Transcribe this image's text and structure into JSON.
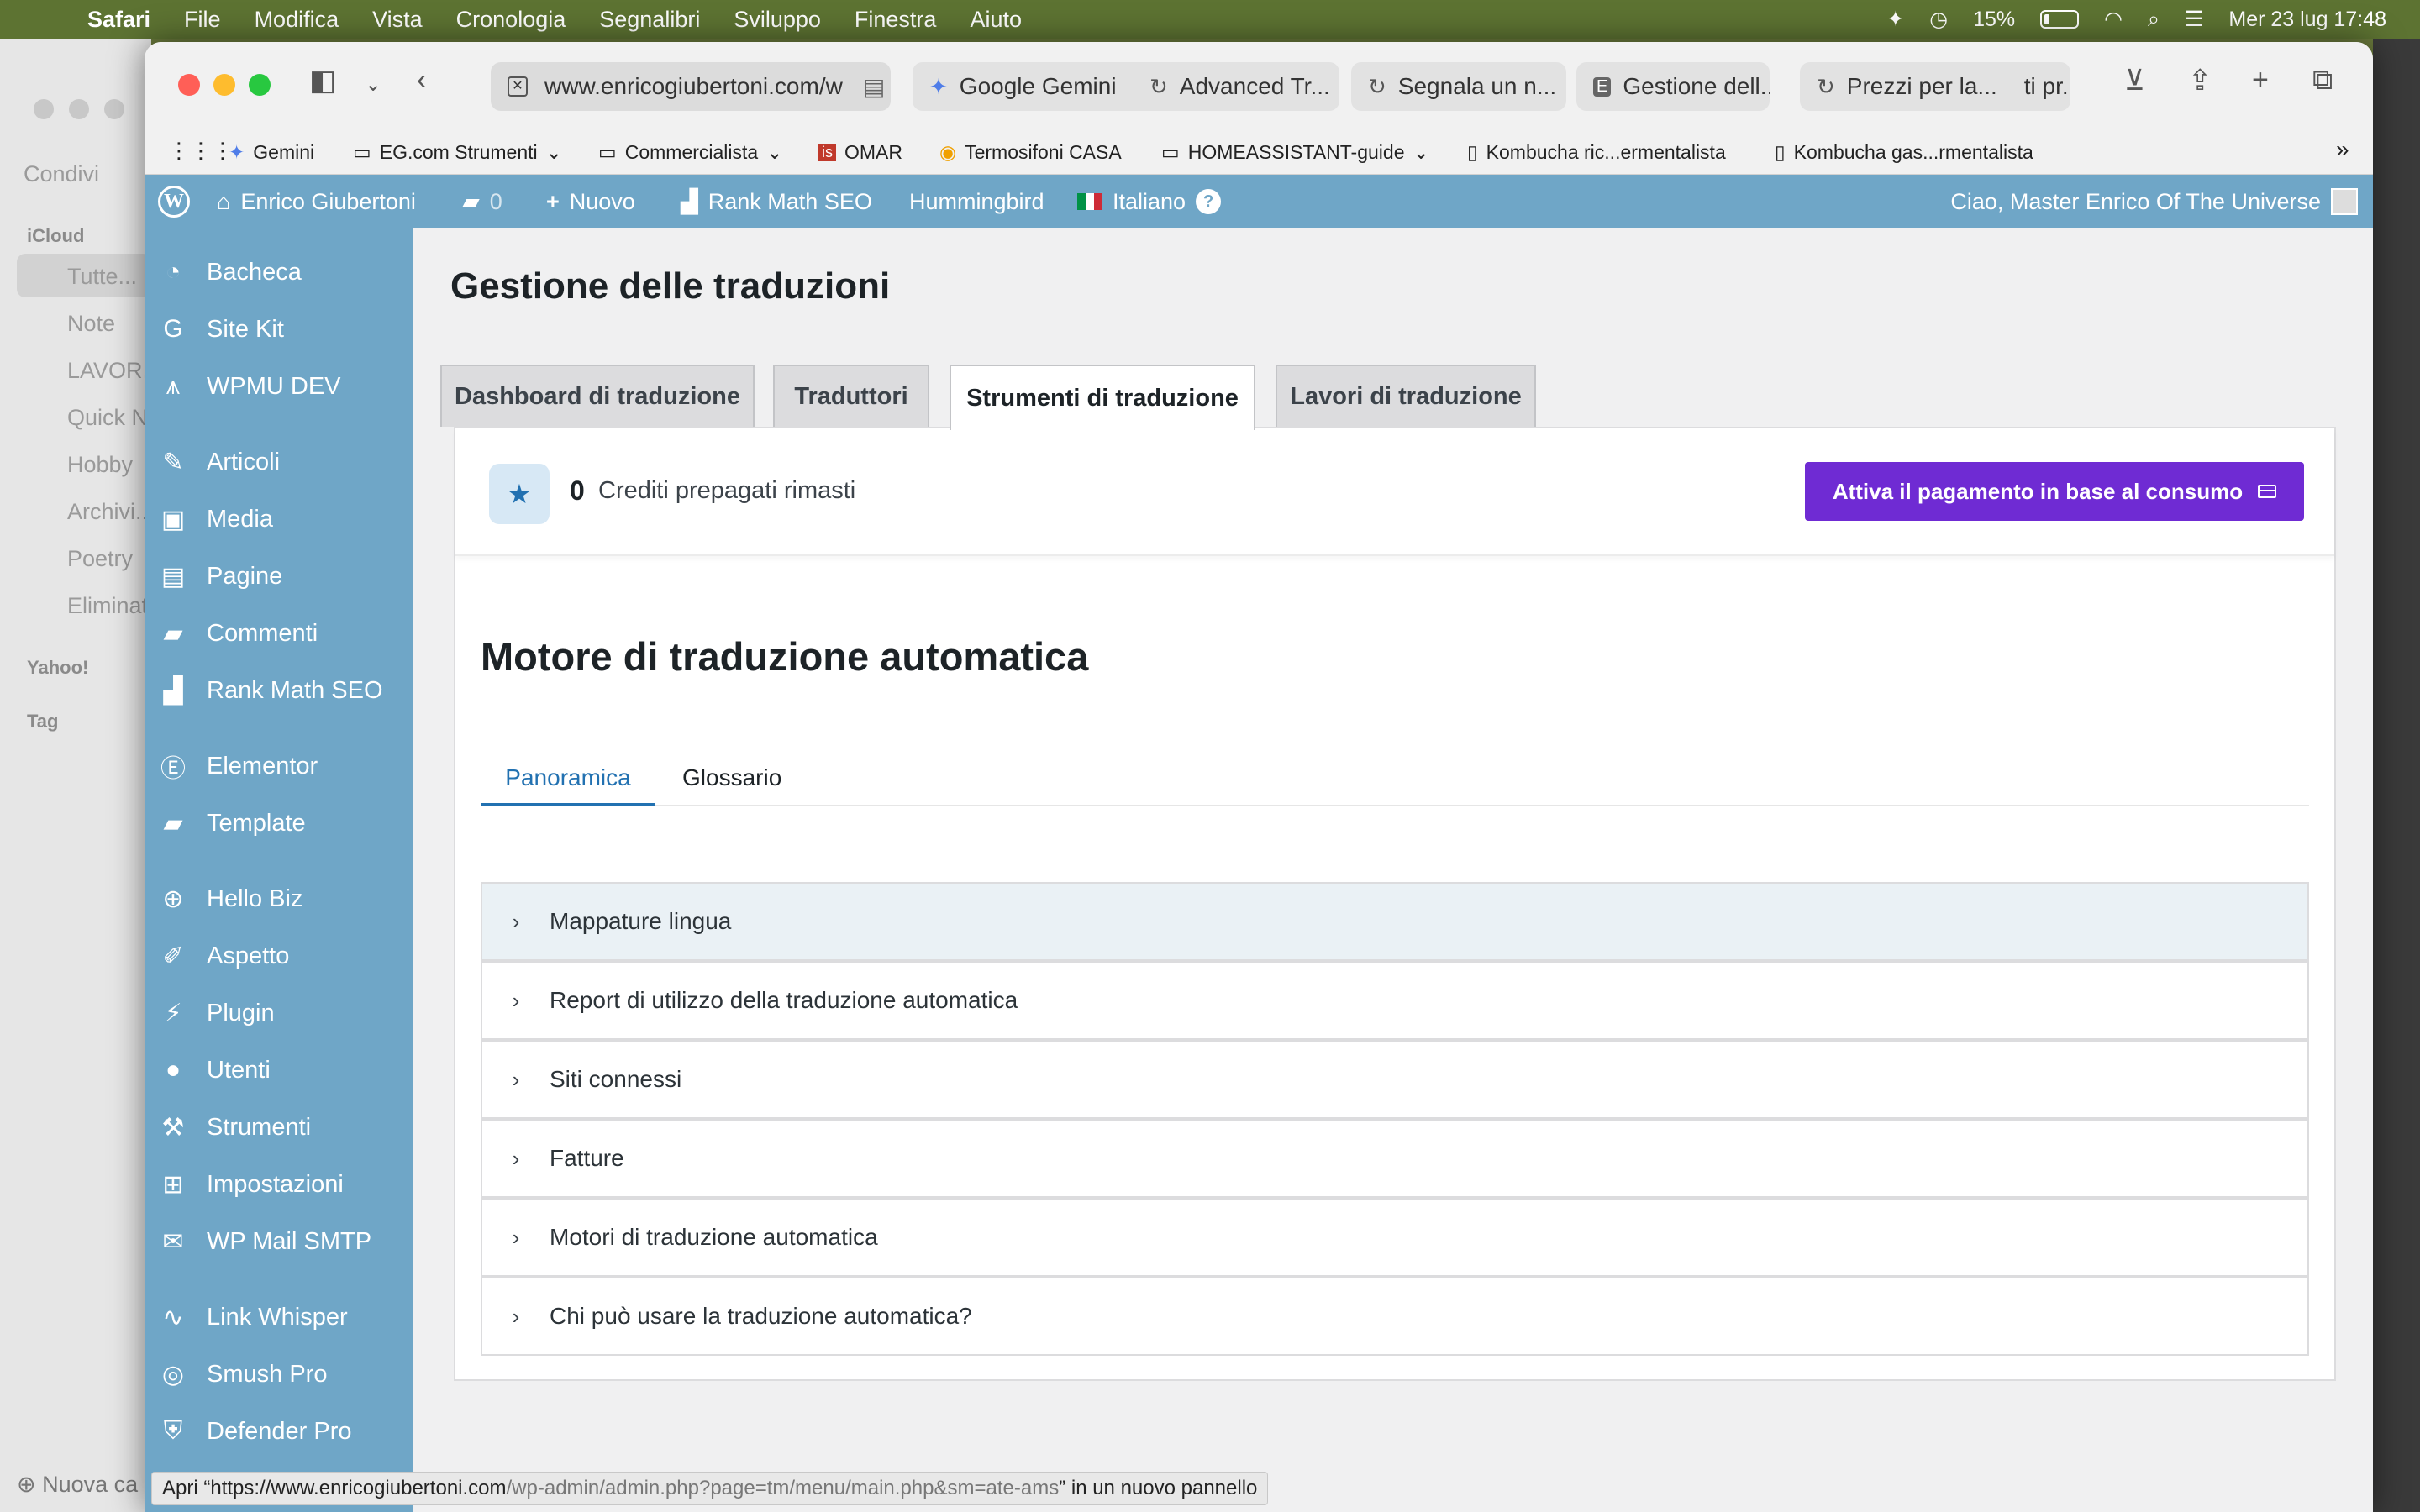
{
  "menubar": {
    "apple": "",
    "items": [
      "Safari",
      "File",
      "Modifica",
      "Vista",
      "Cronologia",
      "Segnalibri",
      "Sviluppo",
      "Finestra",
      "Aiuto"
    ],
    "battery": "15%",
    "datetime": "Mer 23 lug  17:48"
  },
  "notes_app": {
    "items": [
      "Condivi",
      "Tutte...",
      "Note",
      "LAVOR...",
      "Quick N",
      "Hobby",
      "Archivi...",
      "Poetry",
      "Eliminat"
    ],
    "sections": [
      "iCloud",
      "Yahoo!",
      "Tag"
    ],
    "new_folder": "Nuova ca"
  },
  "browser": {
    "address": "www.enricogiubertoni.com/w",
    "tabs": [
      {
        "label": "Google Gemini",
        "icon": "gemini-icon"
      },
      {
        "label": "Advanced Tr...",
        "icon": "reload-icon"
      },
      {
        "label": "Segnala un n...",
        "icon": "reload-icon"
      },
      {
        "label": "Gestione dell...",
        "icon": "e-icon"
      },
      {
        "label": "Prezzi per la...",
        "icon": "reload-icon"
      },
      {
        "label": "ti pr...",
        "icon": ""
      }
    ],
    "bookmarks": [
      "Gemini",
      "EG.com Strumenti",
      "Commercialista",
      "OMAR",
      "Termosifoni CASA",
      "HOMEASSISTANT-guide",
      "Kombucha ric...ermentalista",
      "Kombucha gas...rmentalista"
    ]
  },
  "adminbar": {
    "site": "Enrico Giubertoni",
    "comments": "0",
    "new": "Nuovo",
    "rankmath": "Rank Math SEO",
    "hummingbird": "Hummingbird",
    "language": "Italiano",
    "help": "?",
    "greeting": "Ciao, Master Enrico Of The Universe"
  },
  "sidebar": {
    "items": [
      {
        "label": "Bacheca",
        "icon": "dashboard-icon"
      },
      {
        "label": "Site Kit",
        "icon": "google-g-icon"
      },
      {
        "label": "WPMU DEV",
        "icon": "wpmudev-icon"
      },
      {
        "label": "Articoli",
        "icon": "pin-icon"
      },
      {
        "label": "Media",
        "icon": "media-icon"
      },
      {
        "label": "Pagine",
        "icon": "pages-icon"
      },
      {
        "label": "Commenti",
        "icon": "comment-icon"
      },
      {
        "label": "Rank Math SEO",
        "icon": "rankmath-icon"
      },
      {
        "label": "Elementor",
        "icon": "elementor-icon"
      },
      {
        "label": "Template",
        "icon": "folder-icon"
      },
      {
        "label": "Hello Biz",
        "icon": "plus-circle-icon"
      },
      {
        "label": "Aspetto",
        "icon": "brush-icon"
      },
      {
        "label": "Plugin",
        "icon": "plug-icon"
      },
      {
        "label": "Utenti",
        "icon": "user-icon"
      },
      {
        "label": "Strumenti",
        "icon": "wrench-icon"
      },
      {
        "label": "Impostazioni",
        "icon": "settings-icon"
      },
      {
        "label": "WP Mail SMTP",
        "icon": "mail-icon"
      },
      {
        "label": "Link Whisper",
        "icon": "link-whisper-icon"
      },
      {
        "label": "Smush Pro",
        "icon": "smush-icon"
      },
      {
        "label": "Defender Pro",
        "icon": "shield-icon"
      }
    ]
  },
  "page": {
    "title": "Gestione delle traduzioni",
    "tabs": [
      "Dashboard di traduzione",
      "Traduttori",
      "Strumenti di traduzione",
      "Lavori di traduzione"
    ],
    "active_tab": "Strumenti di traduzione",
    "credits": {
      "count": "0",
      "label": "Crediti prepagati rimasti"
    },
    "activate_button": "Attiva il pagamento in base al consumo",
    "engine_title": "Motore di traduzione automatica",
    "subtabs": [
      "Panoramica",
      "Glossario"
    ],
    "accordion": [
      "Mappature lingua",
      "Report di utilizzo della traduzione automatica",
      "Siti connessi",
      "Fatture",
      "Motori di traduzione automatica",
      "Chi può usare la traduzione automatica?"
    ]
  },
  "status_bar": {
    "prefix": "Apri “",
    "host": "https://www.enricogiubertoni.com",
    "path": "/wp-admin/admin.php?page=tm/menu/main.php&sm=ate-ams",
    "suffix": "” in un nuovo pannello"
  },
  "colors": {
    "wp_admin_blue": "#6fa6c7",
    "primary_purple": "#6f2bd3",
    "link_blue": "#2271b1",
    "menubar_green": "#5d7332"
  }
}
